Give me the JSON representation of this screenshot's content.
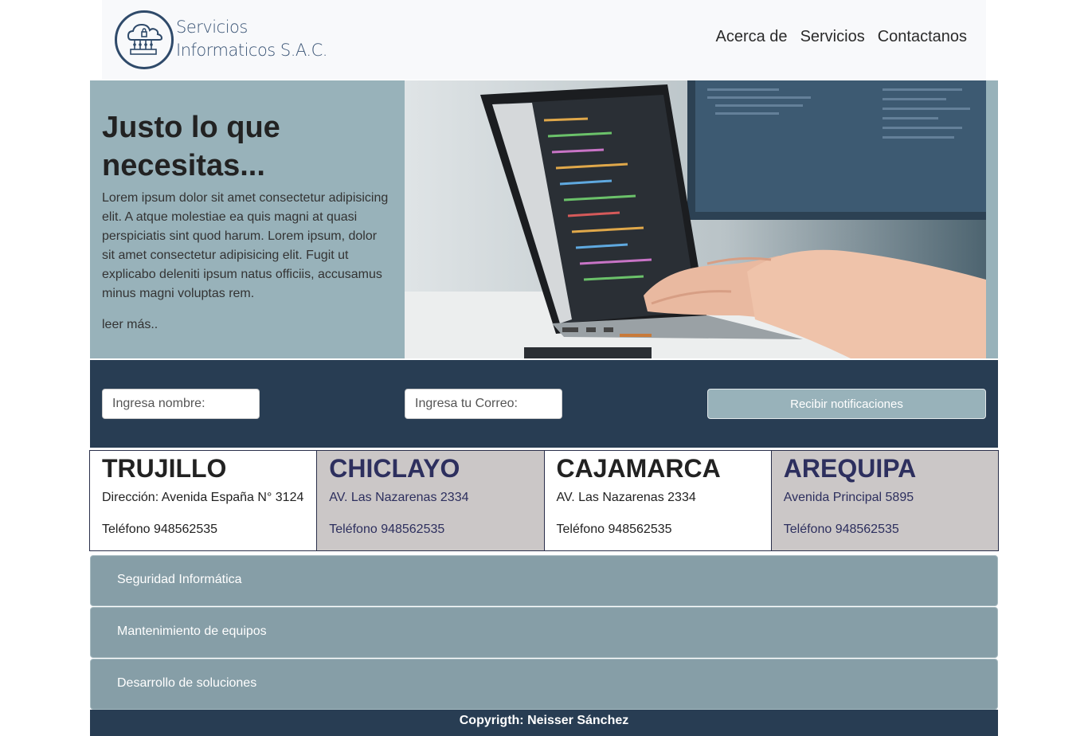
{
  "header": {
    "logo_line1": "Servicios",
    "logo_line2": "Informaticos S.A.C.",
    "nav": [
      "Acerca de",
      "Servicios",
      "Contactanos"
    ]
  },
  "hero": {
    "title": "Justo lo que necesitas...",
    "text": "Lorem ipsum dolor sit amet consectetur adipisicing elit. A atque molestiae ea quis magni at quasi perspiciatis sint quod harum. Lorem ipsum, dolor sit amet consectetur adipisicing elit. Fugit ut explicabo deleniti ipsum natus officiis, accusamus minus magni voluptas rem.",
    "link": "leer más.."
  },
  "subscribe": {
    "name_placeholder": "Ingresa nombre:",
    "email_placeholder": "Ingresa tu Correo:",
    "button": "Recibir notificaciones"
  },
  "cities": [
    {
      "name": "TRUJILLO",
      "address": "Dirección: Avenida España N° 3124",
      "phone": "Teléfono 948562535"
    },
    {
      "name": "CHICLAYO",
      "address": "AV. Las Nazarenas 2334",
      "phone": "Teléfono 948562535"
    },
    {
      "name": "CAJAMARCA",
      "address": "AV. Las Nazarenas 2334",
      "phone": "Teléfono 948562535"
    },
    {
      "name": "AREQUIPA",
      "address": "Avenida Principal 5895",
      "phone": "Teléfono 948562535"
    }
  ],
  "accordion": [
    "Seguridad Informática",
    "Mantenimiento de equipos",
    "Desarrollo de soluciones"
  ],
  "footer": "Copyrigth: Neisser Sánchez",
  "colors": {
    "dark_navy": "#283d53",
    "teal_grey": "#98b2ba",
    "accordion": "#869ea7",
    "card_grey": "#cbc7c7"
  }
}
